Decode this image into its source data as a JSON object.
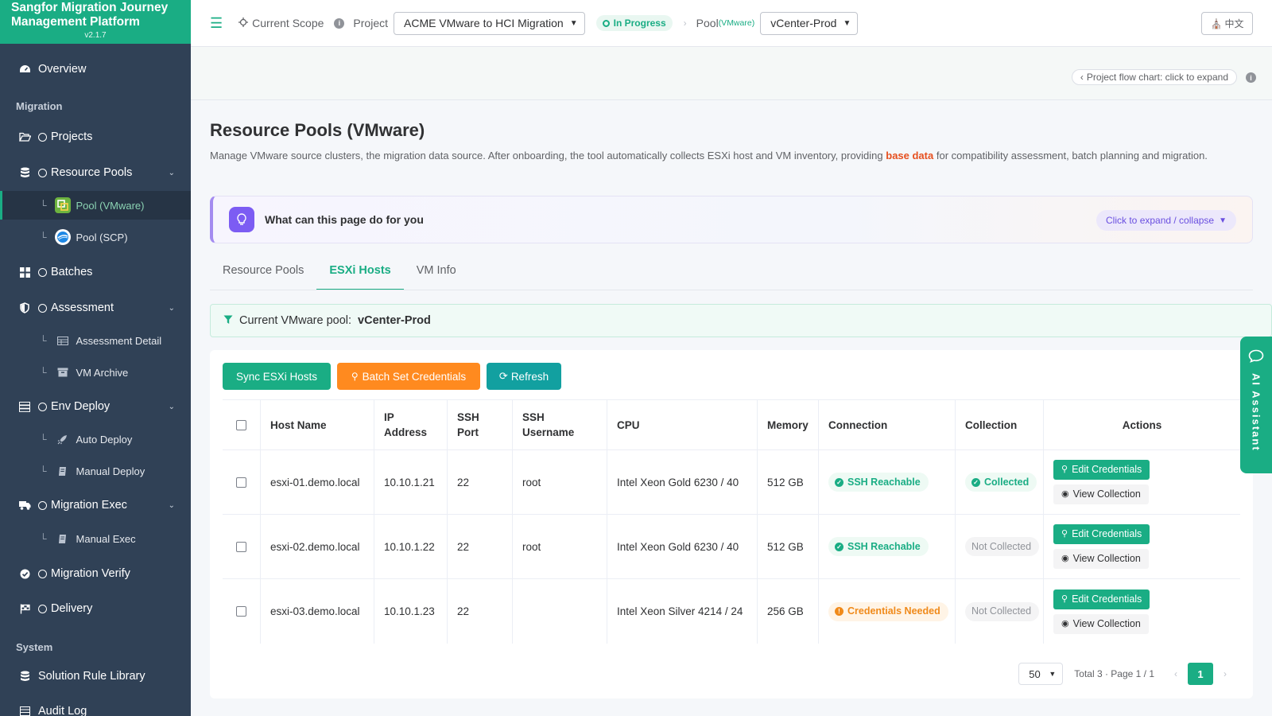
{
  "brand": {
    "title": "Sangfor Migration Journey Management Platform",
    "version": "v2.1.7"
  },
  "sidebar": {
    "overview": "Overview",
    "section_migration": "Migration",
    "projects": "Projects",
    "resource_pools": "Resource Pools",
    "pool_vmware": "Pool (VMware)",
    "pool_scp": "Pool (SCP)",
    "batches": "Batches",
    "assessment": "Assessment",
    "assessment_detail": "Assessment Detail",
    "vm_archive": "VM Archive",
    "env_deploy": "Env Deploy",
    "auto_deploy": "Auto Deploy",
    "manual_deploy": "Manual Deploy",
    "migration_exec": "Migration Exec",
    "manual_exec": "Manual Exec",
    "migration_verify": "Migration Verify",
    "delivery": "Delivery",
    "section_system": "System",
    "solution_rule_library": "Solution Rule Library",
    "audit_log": "Audit Log"
  },
  "topbar": {
    "current_scope": "Current Scope",
    "project_label": "Project",
    "project_value": "ACME VMware to HCI Migration",
    "status": "In Progress",
    "pool_label": "Pool",
    "pool_type": "(VMware)",
    "pool_value": "vCenter-Prod",
    "lang": "中文"
  },
  "flow": {
    "link": "Project flow chart: click to expand"
  },
  "page": {
    "title": "Resource Pools (VMware)",
    "desc_before": "Manage VMware source clusters, the migration data source. After onboarding, the tool automatically collects ESXi host and VM inventory, providing ",
    "desc_bold": "base data",
    "desc_after": " for compatibility assessment, batch planning and migration."
  },
  "help": {
    "title": "What can this page do for you",
    "toggle": "Click to expand / collapse"
  },
  "tabs": [
    "Resource Pools",
    "ESXi Hosts",
    "VM Info"
  ],
  "filter": {
    "label": "Current VMware pool:",
    "value": "vCenter-Prod"
  },
  "toolbar": {
    "sync": "Sync ESXi Hosts",
    "batch": "Batch Set Credentials",
    "refresh": "Refresh"
  },
  "table": {
    "headers": [
      "Host Name",
      "IP Address",
      "SSH Port",
      "SSH Username",
      "CPU",
      "Memory",
      "Connection",
      "Collection",
      "Actions"
    ],
    "rows": [
      {
        "host": "esxi-01.demo.local",
        "ip": "10.10.1.21",
        "port": "22",
        "user": "root",
        "cpu": "Intel Xeon Gold 6230 / 40",
        "mem": "512 GB",
        "conn": "SSH Reachable",
        "coll": "Collected"
      },
      {
        "host": "esxi-02.demo.local",
        "ip": "10.10.1.22",
        "port": "22",
        "user": "root",
        "cpu": "Intel Xeon Gold 6230 / 40",
        "mem": "512 GB",
        "conn": "SSH Reachable",
        "coll": "Not Collected"
      },
      {
        "host": "esxi-03.demo.local",
        "ip": "10.10.1.23",
        "port": "22",
        "user": "",
        "cpu": "Intel Xeon Silver 4214 / 24",
        "mem": "256 GB",
        "conn": "Credentials Needed",
        "coll": "Not Collected"
      }
    ],
    "edit_label": "Edit Credentials",
    "view_label": "View Collection"
  },
  "pager": {
    "size": "50",
    "summary": "Total 3 · Page 1 / 1",
    "current": "1"
  },
  "assistant": {
    "label": "AI Assistant"
  },
  "colors": {
    "accent": "#1aad84",
    "sidebar": "#304156",
    "warning": "#ff8a1f",
    "purple": "#7c5cf3"
  }
}
